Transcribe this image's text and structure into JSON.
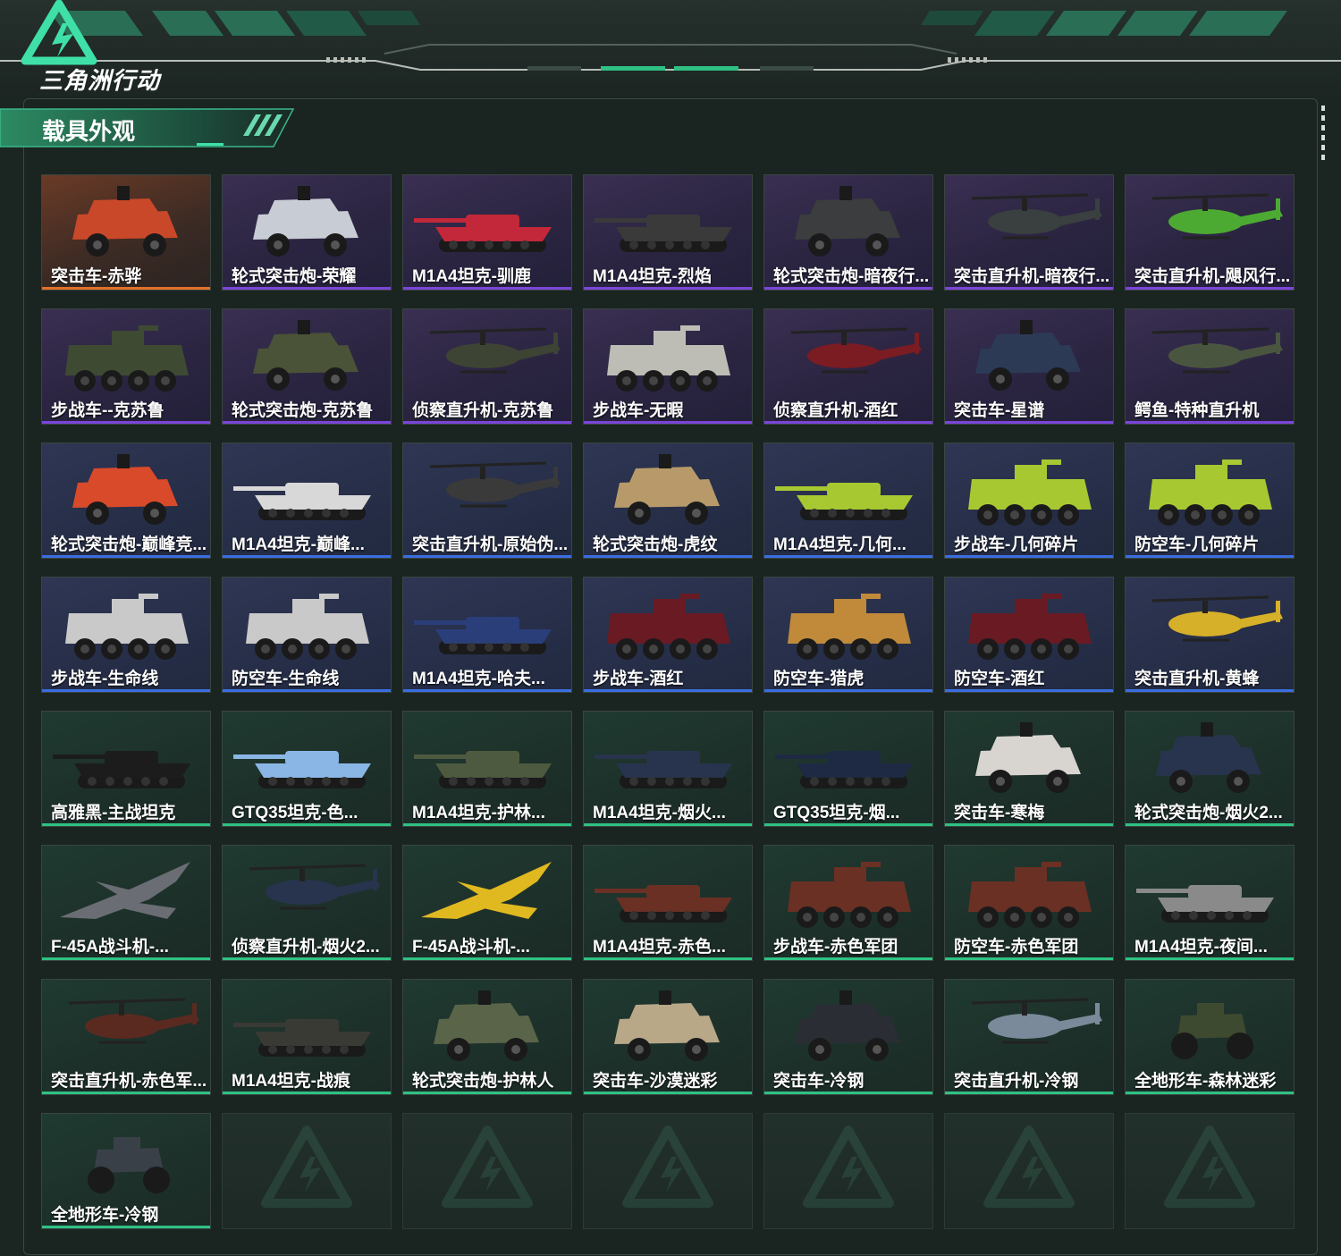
{
  "brand": {
    "logo_text": "三角洲行动"
  },
  "section": {
    "title": "载具外观"
  },
  "rarity_colors": {
    "orange": "#e3712a",
    "purple": "#7b45d9",
    "blue": "#3a6ee0",
    "green": "#2fc183"
  },
  "items": [
    {
      "label": "突击车-赤骅",
      "rarity": "orange",
      "kind": "suv",
      "color": "#c9482a"
    },
    {
      "label": "轮式突击炮-荣耀",
      "rarity": "purple",
      "kind": "suv",
      "color": "#c8ccd4"
    },
    {
      "label": "M1A4坦克-驯鹿",
      "rarity": "purple",
      "kind": "tank",
      "color": "#c2283a"
    },
    {
      "label": "M1A4坦克-烈焰",
      "rarity": "purple",
      "kind": "tank",
      "color": "#3a3a3a"
    },
    {
      "label": "轮式突击炮-暗夜行...",
      "rarity": "purple",
      "kind": "suv",
      "color": "#3b3d3e"
    },
    {
      "label": "突击直升机-暗夜行...",
      "rarity": "purple",
      "kind": "heli",
      "color": "#3a3f3f"
    },
    {
      "label": "突击直升机-飓风行...",
      "rarity": "purple",
      "kind": "heli",
      "color": "#4caa32"
    },
    {
      "label": "步战车--克苏鲁",
      "rarity": "purple",
      "kind": "apc",
      "color": "#3e4a32"
    },
    {
      "label": "轮式突击炮-克苏鲁",
      "rarity": "purple",
      "kind": "suv",
      "color": "#4a5238"
    },
    {
      "label": "侦察直升机-克苏鲁",
      "rarity": "purple",
      "kind": "heli",
      "color": "#3e4434"
    },
    {
      "label": "步战车-无暇",
      "rarity": "purple",
      "kind": "apc",
      "color": "#bdbdb5"
    },
    {
      "label": "侦察直升机-酒红",
      "rarity": "purple",
      "kind": "heli",
      "color": "#7a1c22"
    },
    {
      "label": "突击车-星谱",
      "rarity": "purple",
      "kind": "suv",
      "color": "#2c3a55"
    },
    {
      "label": "鳄鱼-特种直升机",
      "rarity": "purple",
      "kind": "heli",
      "color": "#4a5540"
    },
    {
      "label": "轮式突击炮-巅峰竞...",
      "rarity": "blue",
      "kind": "suv",
      "color": "#d84a2a"
    },
    {
      "label": "M1A4坦克-巅峰...",
      "rarity": "blue",
      "kind": "tank",
      "color": "#d8d8d8"
    },
    {
      "label": "突击直升机-原始伪...",
      "rarity": "blue",
      "kind": "heli",
      "color": "#3a3a3a"
    },
    {
      "label": "轮式突击炮-虎纹",
      "rarity": "blue",
      "kind": "suv",
      "color": "#b89a6a"
    },
    {
      "label": "M1A4坦克-几何...",
      "rarity": "blue",
      "kind": "tank",
      "color": "#a8c832"
    },
    {
      "label": "步战车-几何碎片",
      "rarity": "blue",
      "kind": "apc",
      "color": "#a8c832"
    },
    {
      "label": "防空车-几何碎片",
      "rarity": "blue",
      "kind": "apc",
      "color": "#a8c832"
    },
    {
      "label": "步战车-生命线",
      "rarity": "blue",
      "kind": "apc",
      "color": "#c9c9c9"
    },
    {
      "label": "防空车-生命线",
      "rarity": "blue",
      "kind": "apc",
      "color": "#c9c9c9"
    },
    {
      "label": "M1A4坦克-哈夫...",
      "rarity": "blue",
      "kind": "tank",
      "color": "#2a3e7a"
    },
    {
      "label": "步战车-酒红",
      "rarity": "blue",
      "kind": "apc",
      "color": "#6a1a22"
    },
    {
      "label": "防空车-猎虎",
      "rarity": "blue",
      "kind": "apc",
      "color": "#c08a3a"
    },
    {
      "label": "防空车-酒红",
      "rarity": "blue",
      "kind": "apc",
      "color": "#6a1a22"
    },
    {
      "label": "突击直升机-黄蜂",
      "rarity": "blue",
      "kind": "heli",
      "color": "#d6b028"
    },
    {
      "label": "高雅黑-主战坦克",
      "rarity": "green",
      "kind": "tank",
      "color": "#1c1c1c"
    },
    {
      "label": "GTQ35坦克-色...",
      "rarity": "green",
      "kind": "tank",
      "color": "#8ab6e6"
    },
    {
      "label": "M1A4坦克-护林...",
      "rarity": "green",
      "kind": "tank",
      "color": "#4e5a40"
    },
    {
      "label": "M1A4坦克-烟火...",
      "rarity": "green",
      "kind": "tank",
      "color": "#28344e"
    },
    {
      "label": "GTQ35坦克-烟...",
      "rarity": "green",
      "kind": "tank",
      "color": "#1e2a44"
    },
    {
      "label": "突击车-寒梅",
      "rarity": "green",
      "kind": "suv",
      "color": "#d8d4d0"
    },
    {
      "label": "轮式突击炮-烟火2...",
      "rarity": "green",
      "kind": "suv",
      "color": "#28344e"
    },
    {
      "label": "F-45A战斗机-...",
      "rarity": "green",
      "kind": "jet",
      "color": "#6a6e74"
    },
    {
      "label": "侦察直升机-烟火2...",
      "rarity": "green",
      "kind": "heli",
      "color": "#28344e"
    },
    {
      "label": "F-45A战斗机-...",
      "rarity": "green",
      "kind": "jet",
      "color": "#e0b820"
    },
    {
      "label": "M1A4坦克-赤色...",
      "rarity": "green",
      "kind": "tank",
      "color": "#6a3024"
    },
    {
      "label": "步战车-赤色军团",
      "rarity": "green",
      "kind": "apc",
      "color": "#6a3024"
    },
    {
      "label": "防空车-赤色军团",
      "rarity": "green",
      "kind": "apc",
      "color": "#6a3024"
    },
    {
      "label": "M1A4坦克-夜间...",
      "rarity": "green",
      "kind": "tank",
      "color": "#8a8a8a"
    },
    {
      "label": "突击直升机-赤色军...",
      "rarity": "green",
      "kind": "heli",
      "color": "#5a2a20"
    },
    {
      "label": "M1A4坦克-战痕",
      "rarity": "green",
      "kind": "tank",
      "color": "#3a3a34"
    },
    {
      "label": "轮式突击炮-护林人",
      "rarity": "green",
      "kind": "suv",
      "color": "#5a6448"
    },
    {
      "label": "突击车-沙漠迷彩",
      "rarity": "green",
      "kind": "suv",
      "color": "#b8a888"
    },
    {
      "label": "突击车-冷钢",
      "rarity": "green",
      "kind": "suv",
      "color": "#2a2e34"
    },
    {
      "label": "突击直升机-冷钢",
      "rarity": "green",
      "kind": "heli",
      "color": "#7a8a9a"
    },
    {
      "label": "全地形车-森林迷彩",
      "rarity": "green",
      "kind": "atv",
      "color": "#3e4a30"
    },
    {
      "label": "全地形车-冷钢",
      "rarity": "green",
      "kind": "atv",
      "color": "#3a4048"
    }
  ],
  "empty_slots": 6
}
